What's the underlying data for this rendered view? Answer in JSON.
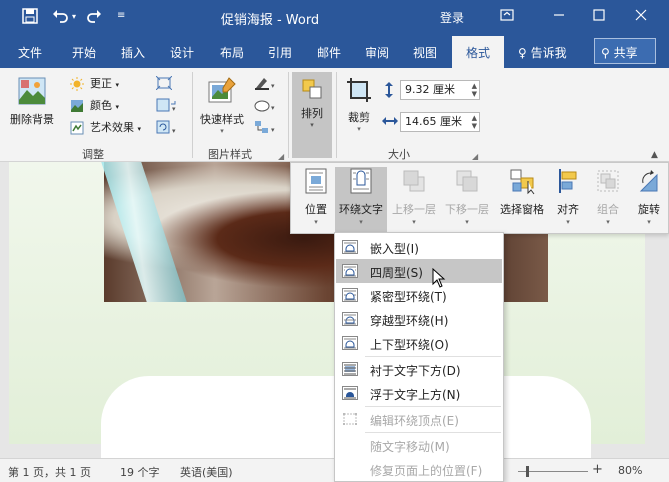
{
  "titlebar": {
    "title": "促销海报 - Word",
    "login": "登录",
    "icons": [
      "save-icon",
      "undo-icon",
      "redo-icon",
      "customize-qat-icon",
      "ribbon-display-icon",
      "minimize-icon",
      "maximize-icon",
      "close-icon"
    ]
  },
  "tabs": {
    "file": "文件",
    "home": "开始",
    "insert": "插入",
    "design": "设计",
    "layout": "布局",
    "references": "引用",
    "mailings": "邮件",
    "review": "审阅",
    "view": "视图",
    "format": "格式",
    "tellme": "告诉我",
    "share": "共享"
  },
  "ribbon": {
    "adjust": {
      "remove_bg": "删除背景",
      "corrections": "更正",
      "color": "颜色",
      "artistic": "艺术效果",
      "label": "调整"
    },
    "picture_styles": {
      "quick_styles": "快速样式",
      "label": "图片样式"
    },
    "arrange": {
      "label": "排列"
    },
    "size": {
      "crop": "裁剪",
      "height": "9.32 厘米",
      "width": "14.65 厘米",
      "label": "大小"
    }
  },
  "arrange_panel": {
    "position": "位置",
    "wrap_text": "环绕文字",
    "bring_forward": "上移一层",
    "send_backward": "下移一层",
    "selection_pane": "选择窗格",
    "align": "对齐",
    "group": "组合",
    "rotate": "旋转"
  },
  "wrap_menu": {
    "items": [
      {
        "label": "嵌入型(I)",
        "enabled": true
      },
      {
        "label": "四周型(S)",
        "enabled": true,
        "highlighted": true
      },
      {
        "label": "紧密型环绕(T)",
        "enabled": true
      },
      {
        "label": "穿越型环绕(H)",
        "enabled": true
      },
      {
        "label": "上下型环绕(O)",
        "enabled": true
      },
      {
        "label": "衬于文字下方(D)",
        "enabled": true
      },
      {
        "label": "浮于文字上方(N)",
        "enabled": true
      },
      {
        "label": "编辑环绕顶点(E)",
        "enabled": false
      },
      {
        "label": "随文字移动(M)",
        "enabled": false
      },
      {
        "label": "修复页面上的位置(F)",
        "enabled": false
      }
    ]
  },
  "statusbar": {
    "page": "第 1 页，共 1 页",
    "words": "19 个字",
    "language": "英语(美国)",
    "zoom": "80%",
    "zoom_plus": "+"
  },
  "colors": {
    "accent": "#2b579a",
    "ribbon_bg": "#f3f3f3",
    "page_green": "#e2efd8"
  }
}
